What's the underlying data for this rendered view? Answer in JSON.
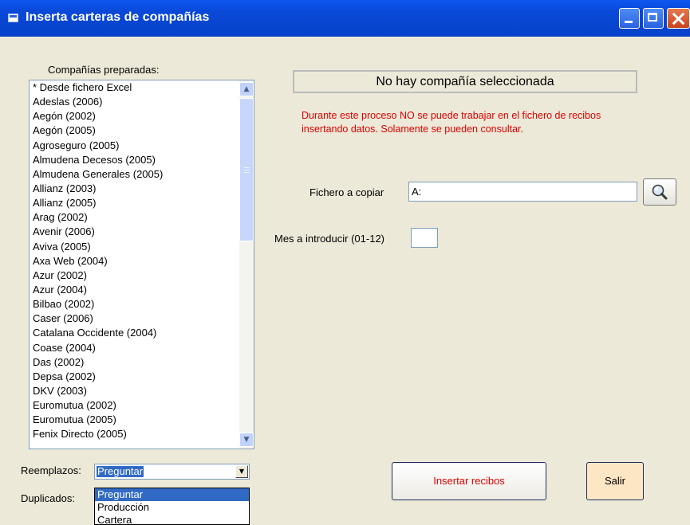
{
  "window": {
    "title": "Inserta carteras de compañías"
  },
  "companies": {
    "label": "Compañías preparadas:",
    "items": [
      "* Desde fichero Excel",
      "Adeslas (2006)",
      "Aegón (2002)",
      "Aegón (2005)",
      "Agroseguro (2005)",
      "Almudena Decesos (2005)",
      "Almudena Generales (2005)",
      "Allianz (2003)",
      "Allianz (2005)",
      "Arag (2002)",
      "Avenir (2006)",
      "Aviva (2005)",
      "Axa Web (2004)",
      "Azur (2002)",
      "Azur (2004)",
      "Bilbao (2002)",
      "Caser (2006)",
      "Catalana Occidente (2004)",
      "Coase (2004)",
      "Das (2002)",
      "Depsa (2002)",
      "DKV (2003)",
      "Euromutua (2002)",
      "Euromutua (2005)",
      "Fenix Directo (2005)"
    ]
  },
  "replacements": {
    "label": "Reemplazos:",
    "selected": "Preguntar",
    "options": [
      "Preguntar",
      "Producción",
      "Cartera"
    ]
  },
  "duplicates": {
    "label": "Duplicados:"
  },
  "status": {
    "text": "No hay compañía seleccionada"
  },
  "warning": {
    "text": "Durante este proceso NO se puede trabajar en el fichero de recibos insertando datos. Solamente se pueden consultar.",
    "color": "#e00000"
  },
  "file_to_copy": {
    "label": "Fichero a copiar",
    "value": "A:"
  },
  "month": {
    "label": "Mes a introducir (01-12)",
    "value": ""
  },
  "buttons": {
    "insert": "Insertar recibos",
    "exit": "Salir"
  },
  "colors": {
    "titlebar": "#0a49d8",
    "background": "#ece9d8",
    "selection": "#316ac5",
    "exit_button": "#fce6c4"
  }
}
